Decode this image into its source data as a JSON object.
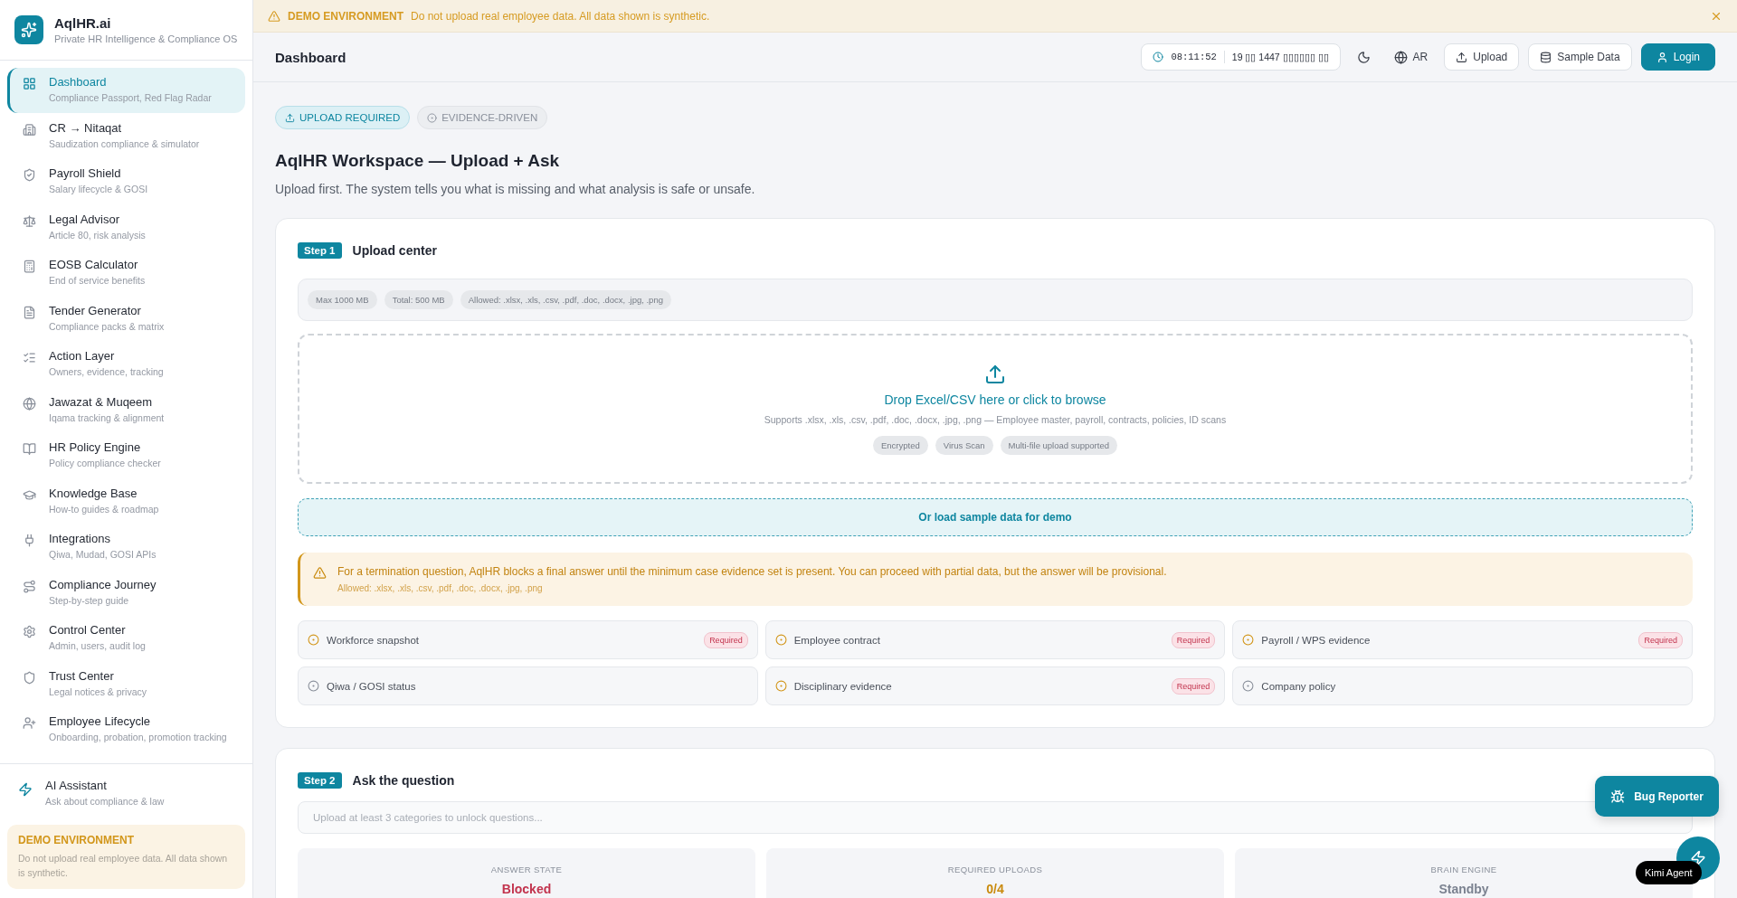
{
  "brand": {
    "name": "AqlHR.ai",
    "tagline": "Private HR Intelligence & Compliance OS"
  },
  "sidebar": {
    "items": [
      {
        "label": "Dashboard",
        "sub": "Compliance Passport, Red Flag Radar",
        "selected": true
      },
      {
        "label": "CR → Nitaqat",
        "sub": "Saudization compliance & simulator",
        "selected": false
      },
      {
        "label": "Payroll Shield",
        "sub": "Salary lifecycle & GOSI",
        "selected": false
      },
      {
        "label": "Legal Advisor",
        "sub": "Article 80, risk analysis",
        "selected": false
      },
      {
        "label": "EOSB Calculator",
        "sub": "End of service benefits",
        "selected": false
      },
      {
        "label": "Tender Generator",
        "sub": "Compliance packs & matrix",
        "selected": false
      },
      {
        "label": "Action Layer",
        "sub": "Owners, evidence, tracking",
        "selected": false
      },
      {
        "label": "Jawazat & Muqeem",
        "sub": "Iqama tracking & alignment",
        "selected": false
      },
      {
        "label": "HR Policy Engine",
        "sub": "Policy compliance checker",
        "selected": false
      },
      {
        "label": "Knowledge Base",
        "sub": "How-to guides & roadmap",
        "selected": false
      },
      {
        "label": "Integrations",
        "sub": "Qiwa, Mudad, GOSI APIs",
        "selected": false
      },
      {
        "label": "Compliance Journey",
        "sub": "Step-by-step guide",
        "selected": false
      },
      {
        "label": "Control Center",
        "sub": "Admin, users, audit log",
        "selected": false
      },
      {
        "label": "Trust Center",
        "sub": "Legal notices & privacy",
        "selected": false
      },
      {
        "label": "Employee Lifecycle",
        "sub": "Onboarding, probation, promotion tracking",
        "selected": false
      }
    ],
    "assistant": {
      "label": "AI Assistant",
      "sub": "Ask about compliance & law"
    },
    "demo": {
      "title": "DEMO ENVIRONMENT",
      "text": "Do not upload real employee data. All data shown is synthetic."
    }
  },
  "banner": {
    "title": "DEMO ENVIRONMENT",
    "text": "Do not upload real employee data. All data shown is synthetic."
  },
  "header": {
    "title": "Dashboard",
    "time": "08:11:52",
    "date": "19 ▯▯ 1447 ▯▯▯▯▯▯ ▯▯",
    "language": "AR",
    "buttons": [
      "Upload",
      "Sample Data"
    ],
    "login": "Login"
  },
  "badges": [
    {
      "label": "UPLOAD REQUIRED",
      "active": true
    },
    {
      "label": "EVIDENCE-DRIVEN",
      "active": false
    }
  ],
  "page": {
    "title": "AqlHR Workspace — Upload + Ask",
    "subtitle": "Upload first. The system tells you what is missing and what analysis is safe or unsafe."
  },
  "step1": {
    "step": "Step 1",
    "title": "Upload center",
    "limits": [
      "Max 1000 MB",
      "Total: 500 MB",
      "Allowed: .xlsx, .xls, .csv, .pdf, .doc, .docx, .jpg, .png"
    ],
    "drop": {
      "title": "Drop Excel/CSV here or click to browse",
      "text": "Supports .xlsx, .xls, .csv, .pdf, .doc, .docx, .jpg, .png — Employee master, payroll, contracts, policies, ID scans",
      "tags": [
        "Encrypted",
        "Virus Scan",
        "Multi-file upload supported"
      ]
    },
    "sample": "Or load sample data for demo",
    "warning": {
      "text": "For a termination question, AqlHR blocks a final answer until the minimum case evidence set is present. You can proceed with partial data, but the answer will be provisional.",
      "note": "Allowed: .xlsx, .xls, .csv, .pdf, .doc, .docx, .jpg, .png"
    },
    "requirements": [
      {
        "label": "Workforce snapshot",
        "required": true,
        "badge": "Required"
      },
      {
        "label": "Employee contract",
        "required": true,
        "badge": "Required"
      },
      {
        "label": "Payroll / WPS evidence",
        "required": true,
        "badge": "Required"
      },
      {
        "label": "Qiwa / GOSI status",
        "required": false
      },
      {
        "label": "Disciplinary evidence",
        "required": true,
        "badge": "Required"
      },
      {
        "label": "Company policy",
        "required": false
      }
    ]
  },
  "step2": {
    "step": "Step 2",
    "title": "Ask the question",
    "placeholder": "Upload at least 3 categories to unlock questions...",
    "stats": [
      {
        "label": "ANSWER STATE",
        "value": "Blocked",
        "color": "#c2334d"
      },
      {
        "label": "REQUIRED UPLOADS",
        "value": "0/4",
        "color": "#c98a0c"
      },
      {
        "label": "BRAIN ENGINE",
        "value": "Standby",
        "color": "#7b8290"
      }
    ]
  },
  "floating": {
    "bug": "Bug Reporter",
    "agent": "Kimi Agent"
  }
}
